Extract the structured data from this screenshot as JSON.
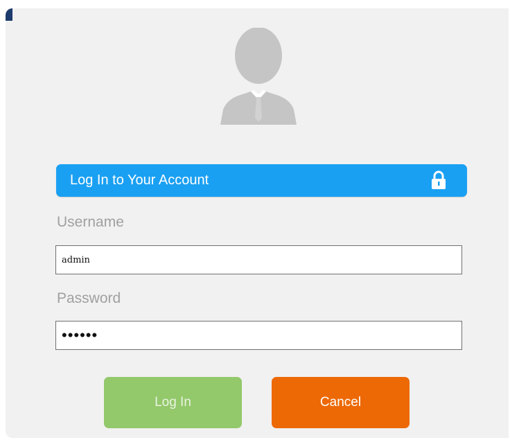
{
  "login": {
    "header_title": "Log In to Your Account",
    "username_label": "Username",
    "username_value": "admin",
    "password_label": "Password",
    "password_value": "••••••",
    "login_button": "Log In",
    "cancel_button": "Cancel"
  },
  "icons": {
    "avatar": "user-silhouette-icon",
    "lock": "lock-icon"
  },
  "colors": {
    "header_blue": "#1aa0f3",
    "login_green": "#93c86b",
    "cancel_orange": "#ec6906",
    "panel_bg": "#f1f1f1"
  }
}
